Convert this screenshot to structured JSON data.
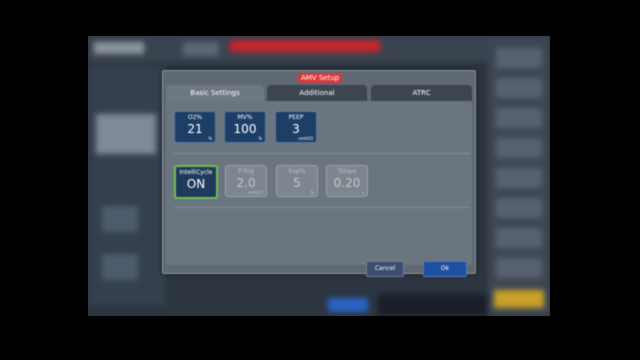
{
  "dialog": {
    "title": "AMV Setup",
    "tabs": [
      {
        "label": "Basic Settings",
        "active": true
      },
      {
        "label": "Additional",
        "active": false
      },
      {
        "label": "ATRC",
        "active": false
      }
    ],
    "row1": [
      {
        "label": "O2%",
        "value": "21",
        "unit": "%"
      },
      {
        "label": "MV%",
        "value": "100",
        "unit": "%"
      },
      {
        "label": "PEEP",
        "value": "3",
        "unit": "cmH2O"
      }
    ],
    "row2": [
      {
        "label": "IntelliCycle",
        "value": "ON",
        "state": "selected"
      },
      {
        "label": "P-Trig",
        "value": "2.0",
        "unit": "cmH2O",
        "state": "disabled"
      },
      {
        "label": "Exp%",
        "value": "5",
        "unit": "%",
        "state": "disabled"
      },
      {
        "label": "Tslope",
        "value": "0.20",
        "unit": "s",
        "state": "disabled"
      }
    ],
    "footer": {
      "cancel_label": "Cancel",
      "ok_label": "Ok"
    }
  },
  "colors": {
    "alarm_red": "#d9373b",
    "active_green": "#6fbf4a",
    "ok_blue": "#1f4fa0"
  }
}
